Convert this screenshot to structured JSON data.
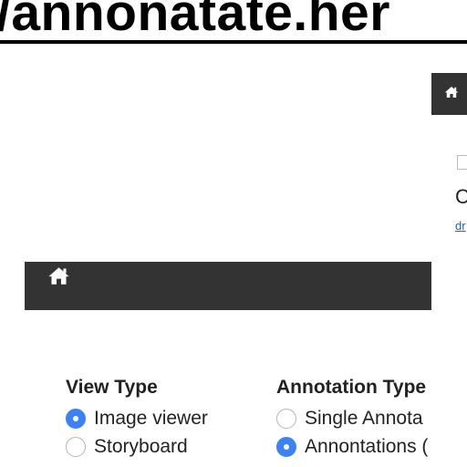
{
  "url_banner": "/annonatate.her",
  "right_panel": {
    "heading_partial": "C",
    "link_partial": "dr"
  },
  "icons": {
    "nav_home": "home-icon"
  },
  "colors": {
    "navbar_bg": "#333333",
    "radio_checked": "#3b82f6",
    "link": "#1a5fd0"
  },
  "view_type": {
    "title": "View Type",
    "options": [
      {
        "label": "Image viewer",
        "checked": true
      },
      {
        "label": "Storyboard",
        "checked": false
      }
    ]
  },
  "annotation_type": {
    "title": "Annotation Type",
    "options": [
      {
        "label": "Single Annota",
        "checked": false
      },
      {
        "label": "Annontations (",
        "checked": true
      }
    ]
  }
}
